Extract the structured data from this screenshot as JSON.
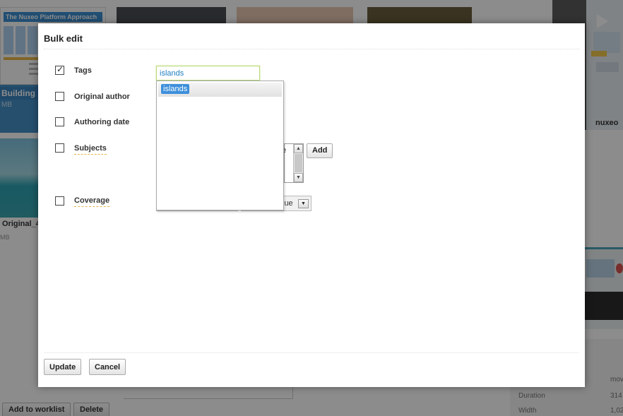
{
  "background": {
    "thumb1_title": "The Nuxeo Platform Approach",
    "thumb5_label": "Building",
    "thumb5_size": "MB",
    "thumb6_label": "Original_4",
    "thumb6_size": "MB",
    "thumb7_label": "nuxeo",
    "metadata": [
      {
        "label": "Duration",
        "value": "314"
      },
      {
        "label": "Width",
        "value": "1,02"
      }
    ],
    "metadata_partial": "n",
    "metadata_partial2": "mov",
    "buttons": {
      "add_to_worklist": "Add to worklist",
      "delete": "Delete"
    }
  },
  "modal": {
    "title": "Bulk edit",
    "fields": {
      "tags": {
        "label": "Tags",
        "checked": true,
        "value": "islands",
        "suggestion": "islands"
      },
      "original_author": {
        "label": "Original author",
        "checked": false
      },
      "authoring_date": {
        "label": "Authoring date",
        "checked": false
      },
      "subjects": {
        "label": "Subjects",
        "checked": false,
        "list_fragment": "e",
        "add_label": "Add"
      },
      "coverage": {
        "label": "Coverage",
        "checked": false,
        "select_value": "lue"
      }
    },
    "footer": {
      "update_label": "Update",
      "cancel_label": "Cancel"
    }
  }
}
